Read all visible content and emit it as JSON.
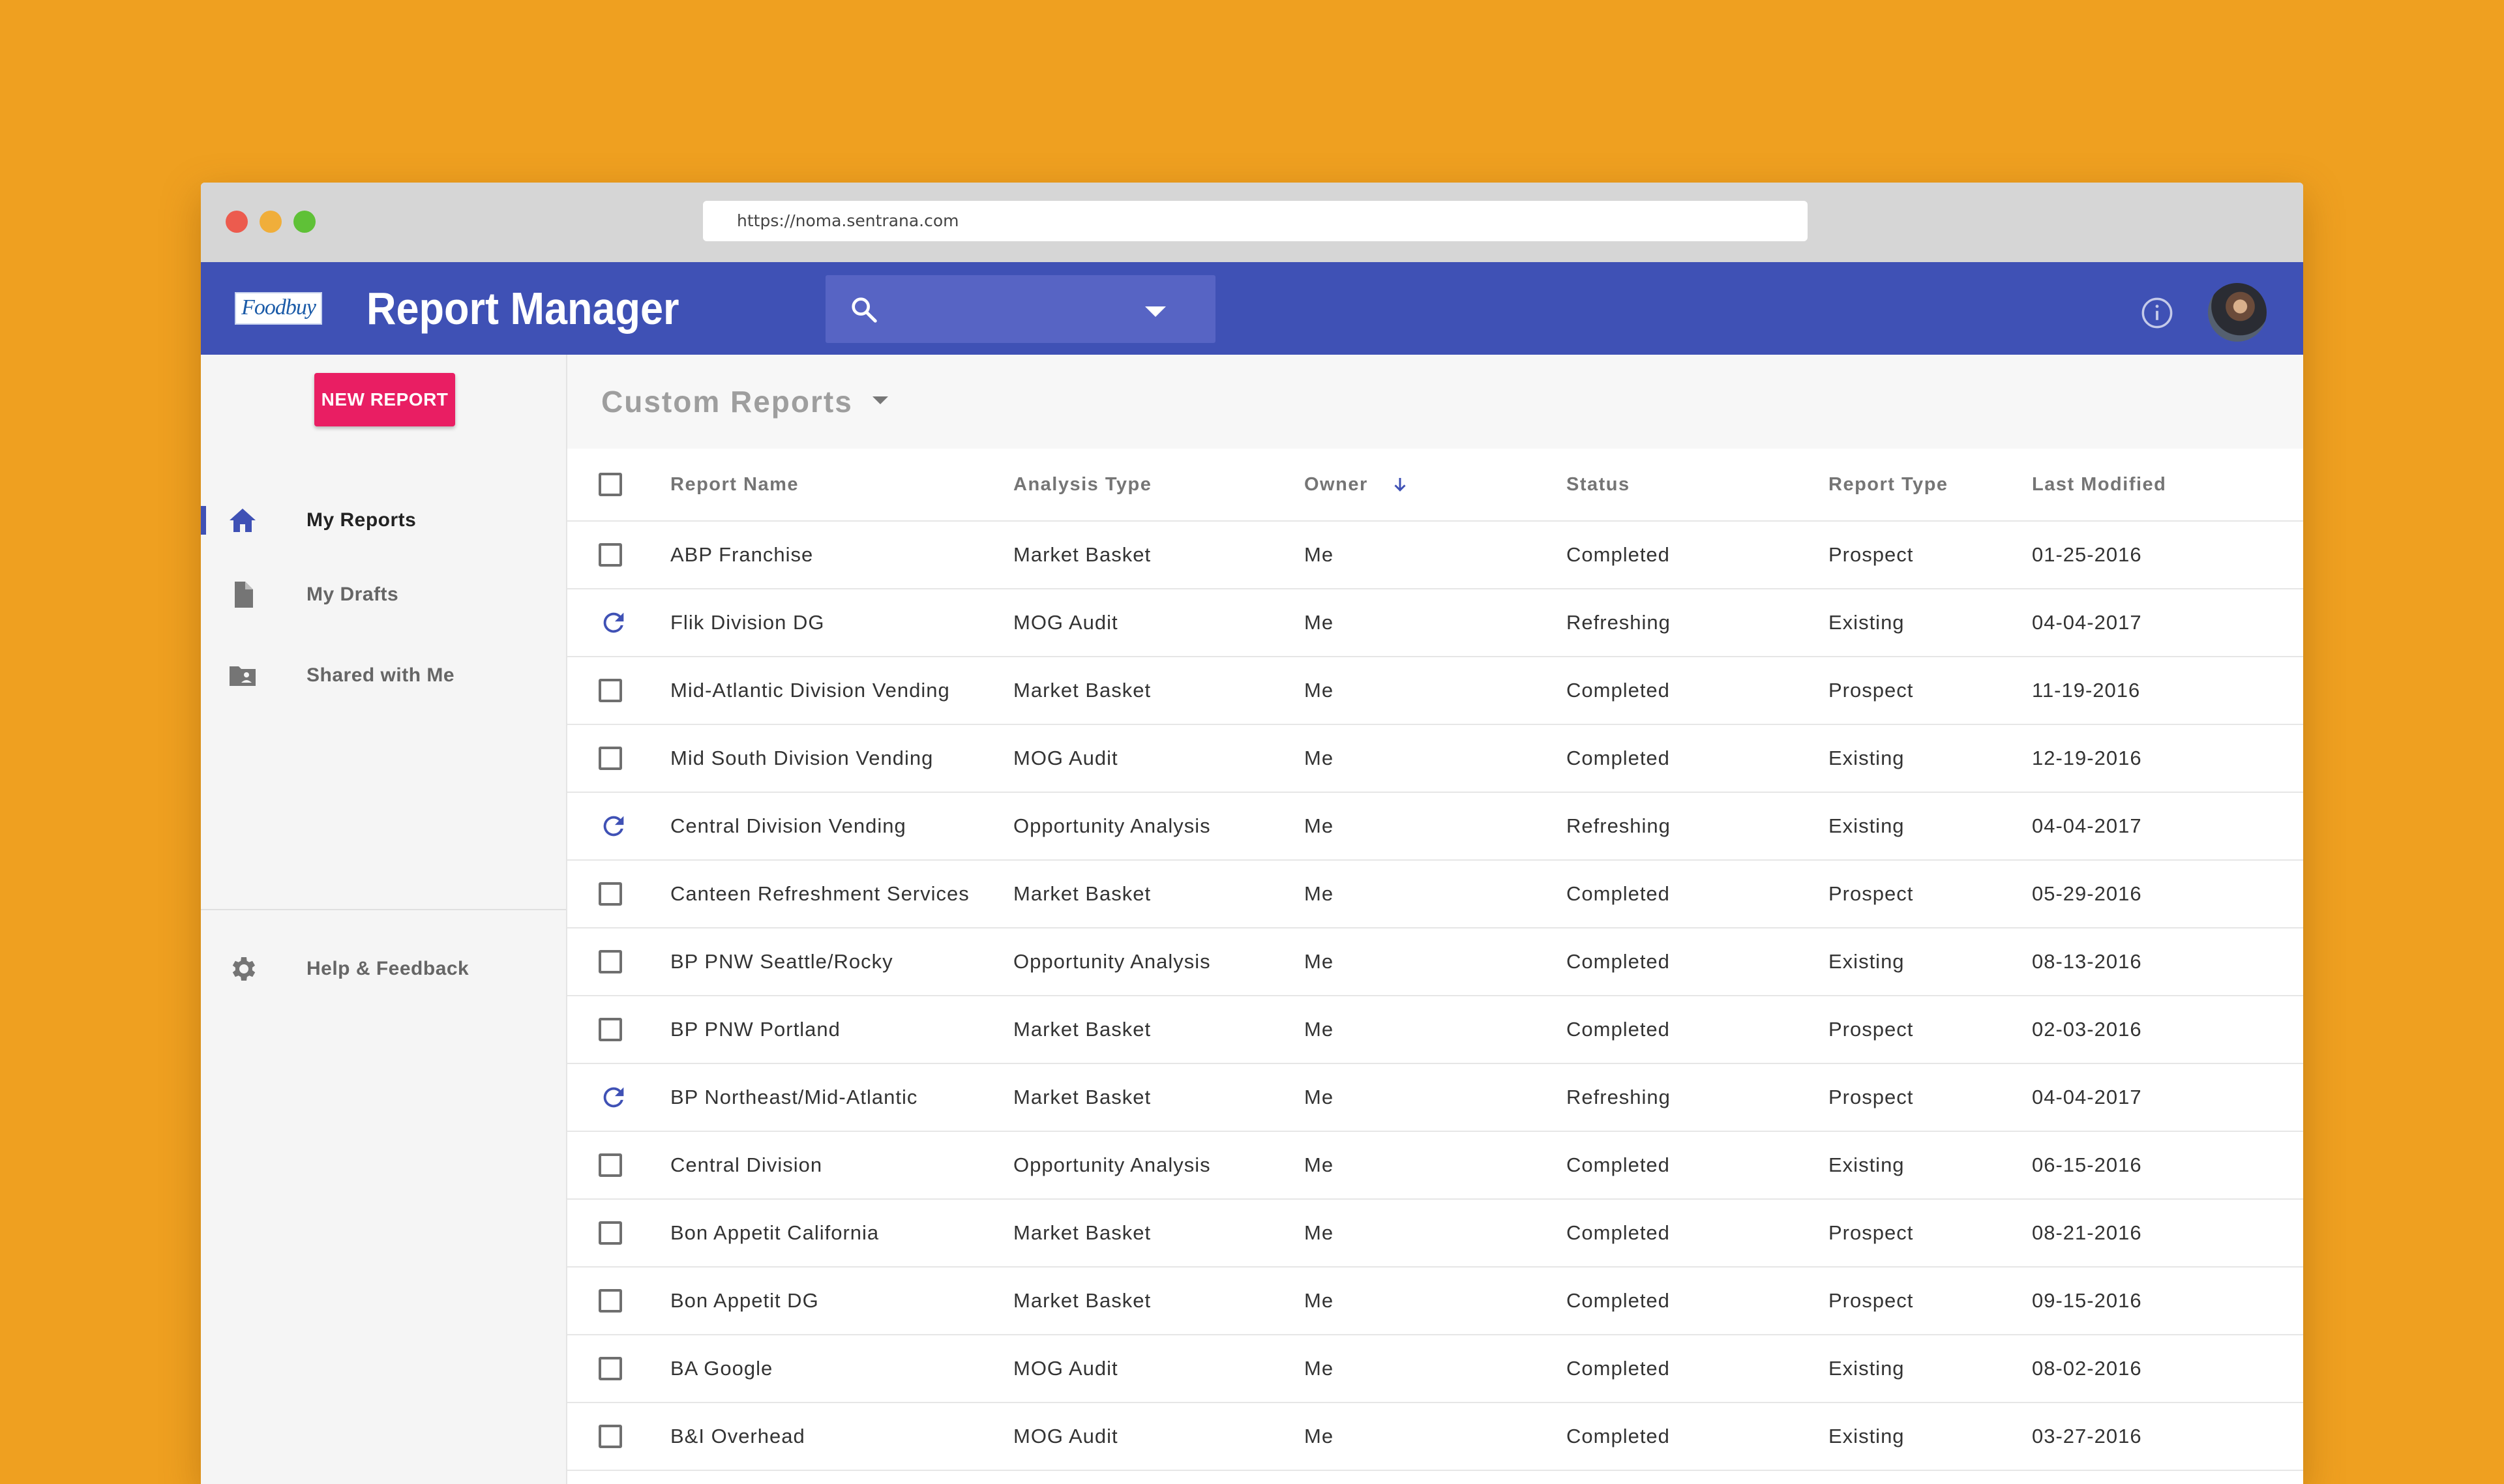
{
  "browser": {
    "url": "https://noma.sentrana.com"
  },
  "appbar": {
    "logo_text": "Foodbuy",
    "title": "Report Manager",
    "search": {
      "placeholder": ""
    },
    "icons": [
      "search-icon",
      "chevron-down-icon",
      "info-icon",
      "avatar"
    ]
  },
  "sidebar": {
    "new_report_label": "NEW REPORT",
    "items": [
      {
        "label": "My Reports",
        "icon": "home-icon",
        "active": true
      },
      {
        "label": "My Drafts",
        "icon": "document-icon",
        "active": false
      },
      {
        "label": "Shared with Me",
        "icon": "shared-folder-icon",
        "active": false
      }
    ],
    "footer_items": [
      {
        "label": "Help & Feedback",
        "icon": "gear-icon"
      }
    ]
  },
  "main": {
    "section_title": "Custom Reports",
    "table": {
      "columns": [
        "Report Name",
        "Analysis Type",
        "Owner",
        "Status",
        "Report Type",
        "Last Modified"
      ],
      "sorted_column": "Owner",
      "sort_direction": "descending",
      "rows": [
        {
          "name": "ABP Franchise",
          "analysis": "Market Basket",
          "owner": "Me",
          "status": "Completed",
          "type": "Prospect",
          "modified": "01-25-2016"
        },
        {
          "name": "Flik Division DG",
          "analysis": "MOG Audit",
          "owner": "Me",
          "status": "Refreshing",
          "type": "Existing",
          "modified": "04-04-2017"
        },
        {
          "name": "Mid-Atlantic Division Vending",
          "analysis": "Market Basket",
          "owner": "Me",
          "status": "Completed",
          "type": "Prospect",
          "modified": "11-19-2016"
        },
        {
          "name": "Mid South Division Vending",
          "analysis": "MOG Audit",
          "owner": "Me",
          "status": "Completed",
          "type": "Existing",
          "modified": "12-19-2016"
        },
        {
          "name": "Central Division Vending",
          "analysis": "Opportunity Analysis",
          "owner": "Me",
          "status": "Refreshing",
          "type": "Existing",
          "modified": "04-04-2017"
        },
        {
          "name": "Canteen Refreshment Services",
          "analysis": "Market Basket",
          "owner": "Me",
          "status": "Completed",
          "type": "Prospect",
          "modified": "05-29-2016"
        },
        {
          "name": "BP PNW Seattle/Rocky",
          "analysis": "Opportunity Analysis",
          "owner": "Me",
          "status": "Completed",
          "type": "Existing",
          "modified": "08-13-2016"
        },
        {
          "name": "BP PNW Portland",
          "analysis": "Market Basket",
          "owner": "Me",
          "status": "Completed",
          "type": "Prospect",
          "modified": "02-03-2016"
        },
        {
          "name": "BP Northeast/Mid-Atlantic",
          "analysis": "Market Basket",
          "owner": "Me",
          "status": "Refreshing",
          "type": "Prospect",
          "modified": "04-04-2017"
        },
        {
          "name": "Central Division",
          "analysis": "Opportunity Analysis",
          "owner": "Me",
          "status": "Completed",
          "type": "Existing",
          "modified": "06-15-2016"
        },
        {
          "name": "Bon Appetit California",
          "analysis": "Market Basket",
          "owner": "Me",
          "status": "Completed",
          "type": "Prospect",
          "modified": "08-21-2016"
        },
        {
          "name": "Bon Appetit DG",
          "analysis": "Market Basket",
          "owner": "Me",
          "status": "Completed",
          "type": "Prospect",
          "modified": "09-15-2016"
        },
        {
          "name": "BA Google",
          "analysis": "MOG Audit",
          "owner": "Me",
          "status": "Completed",
          "type": "Existing",
          "modified": "08-02-2016"
        },
        {
          "name": "B&I Overhead",
          "analysis": "MOG Audit",
          "owner": "Me",
          "status": "Completed",
          "type": "Existing",
          "modified": "03-27-2016"
        }
      ]
    }
  },
  "colors": {
    "background": "#EFA020",
    "appbar": "#3F51B5",
    "accent": "#E91E63",
    "refresh_icon": "#3F51B5"
  }
}
